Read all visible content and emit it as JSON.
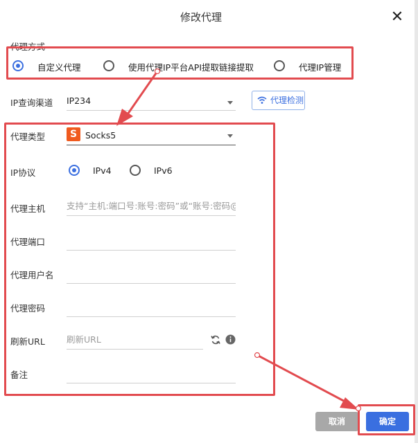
{
  "dialog": {
    "title": "修改代理",
    "close_glyph": "✕"
  },
  "proxy_mode": {
    "label": "代理方式",
    "options": [
      {
        "label": "自定义代理",
        "selected": true
      },
      {
        "label": "使用代理IP平台API提取链接提取",
        "selected": false
      },
      {
        "label": "代理IP管理",
        "selected": false
      }
    ]
  },
  "ip_channel": {
    "label": "IP查询渠道",
    "value": "IP234",
    "check_button": "代理检测",
    "check_icon": "wifi-icon"
  },
  "proxy_type": {
    "label": "代理类型",
    "value": "Socks5",
    "icon_letter": "S",
    "icon_color": "#f05a1e"
  },
  "ip_protocol": {
    "label": "IP协议",
    "options": [
      {
        "label": "IPv4",
        "selected": true
      },
      {
        "label": "IPv6",
        "selected": false
      }
    ]
  },
  "host": {
    "label": "代理主机",
    "placeholder": "支持“主机:端口号:账号:密码”或“账号:密码@主机"
  },
  "port": {
    "label": "代理端口",
    "value": ""
  },
  "username": {
    "label": "代理用户名",
    "value": ""
  },
  "password": {
    "label": "代理密码",
    "value": ""
  },
  "refresh_url": {
    "label": "刷新URL",
    "placeholder": "刷新URL"
  },
  "note": {
    "label": "备注",
    "value": ""
  },
  "footer": {
    "cancel_label": "取消",
    "ok_label": "确定"
  },
  "colors": {
    "accent": "#3b6fe0",
    "annotation_red": "#e24b4f",
    "cancel_gray": "#a8a8a8"
  }
}
